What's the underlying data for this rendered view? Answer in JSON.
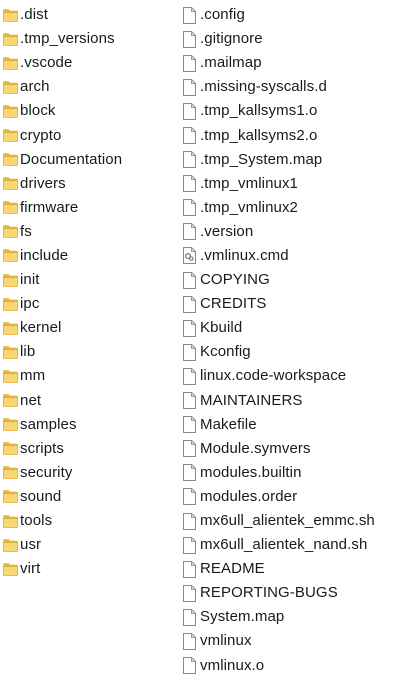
{
  "folders": [
    {
      "name": ".dist",
      "icon": "folder-icon"
    },
    {
      "name": ".tmp_versions",
      "icon": "folder-icon"
    },
    {
      "name": ".vscode",
      "icon": "folder-icon"
    },
    {
      "name": "arch",
      "icon": "folder-icon"
    },
    {
      "name": "block",
      "icon": "folder-icon"
    },
    {
      "name": "crypto",
      "icon": "folder-icon"
    },
    {
      "name": "Documentation",
      "icon": "folder-icon"
    },
    {
      "name": "drivers",
      "icon": "folder-icon"
    },
    {
      "name": "firmware",
      "icon": "folder-icon"
    },
    {
      "name": "fs",
      "icon": "folder-icon"
    },
    {
      "name": "include",
      "icon": "folder-icon"
    },
    {
      "name": "init",
      "icon": "folder-icon"
    },
    {
      "name": "ipc",
      "icon": "folder-icon"
    },
    {
      "name": "kernel",
      "icon": "folder-icon"
    },
    {
      "name": "lib",
      "icon": "folder-icon"
    },
    {
      "name": "mm",
      "icon": "folder-icon"
    },
    {
      "name": "net",
      "icon": "folder-icon"
    },
    {
      "name": "samples",
      "icon": "folder-icon"
    },
    {
      "name": "scripts",
      "icon": "folder-icon"
    },
    {
      "name": "security",
      "icon": "folder-icon"
    },
    {
      "name": "sound",
      "icon": "folder-icon"
    },
    {
      "name": "tools",
      "icon": "folder-icon"
    },
    {
      "name": "usr",
      "icon": "folder-icon"
    },
    {
      "name": "virt",
      "icon": "folder-icon"
    }
  ],
  "files": [
    {
      "name": ".config",
      "icon": "file-icon"
    },
    {
      "name": ".gitignore",
      "icon": "file-icon"
    },
    {
      "name": ".mailmap",
      "icon": "file-icon"
    },
    {
      "name": ".missing-syscalls.d",
      "icon": "file-icon"
    },
    {
      "name": ".tmp_kallsyms1.o",
      "icon": "file-icon"
    },
    {
      "name": ".tmp_kallsyms2.o",
      "icon": "file-icon"
    },
    {
      "name": ".tmp_System.map",
      "icon": "file-icon"
    },
    {
      "name": ".tmp_vmlinux1",
      "icon": "file-icon"
    },
    {
      "name": ".tmp_vmlinux2",
      "icon": "file-icon"
    },
    {
      "name": ".version",
      "icon": "file-icon"
    },
    {
      "name": ".vmlinux.cmd",
      "icon": "cmd-file-icon"
    },
    {
      "name": "COPYING",
      "icon": "file-icon"
    },
    {
      "name": "CREDITS",
      "icon": "file-icon"
    },
    {
      "name": "Kbuild",
      "icon": "file-icon"
    },
    {
      "name": "Kconfig",
      "icon": "file-icon"
    },
    {
      "name": "linux.code-workspace",
      "icon": "file-icon"
    },
    {
      "name": "MAINTAINERS",
      "icon": "file-icon"
    },
    {
      "name": "Makefile",
      "icon": "file-icon"
    },
    {
      "name": "Module.symvers",
      "icon": "file-icon"
    },
    {
      "name": "modules.builtin",
      "icon": "file-icon"
    },
    {
      "name": "modules.order",
      "icon": "file-icon"
    },
    {
      "name": "mx6ull_alientek_emmc.sh",
      "icon": "file-icon"
    },
    {
      "name": "mx6ull_alientek_nand.sh",
      "icon": "file-icon"
    },
    {
      "name": "README",
      "icon": "file-icon"
    },
    {
      "name": "REPORTING-BUGS",
      "icon": "file-icon"
    },
    {
      "name": "System.map",
      "icon": "file-icon"
    },
    {
      "name": "vmlinux",
      "icon": "file-icon"
    },
    {
      "name": "vmlinux.o",
      "icon": "file-icon"
    }
  ],
  "colors": {
    "folder_body": "#F8D775",
    "folder_tab": "#E8B83E",
    "folder_edge": "#D9A62C",
    "file_border": "#8A8A8A",
    "file_fill": "#FFFFFF",
    "cmd_accent": "#6A7F94",
    "text": "#1A1A1A"
  }
}
